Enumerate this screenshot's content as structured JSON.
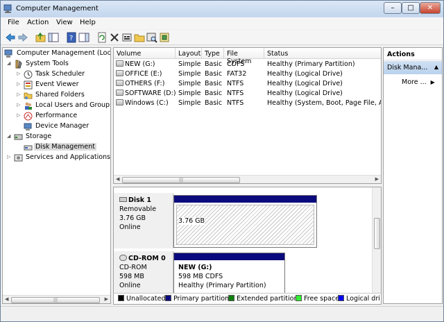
{
  "window": {
    "title": "Computer Management",
    "minimize": "–",
    "maximize": "□",
    "close": "✕"
  },
  "menu": [
    "File",
    "Action",
    "View",
    "Help"
  ],
  "toolbar_icons": [
    "back-arrow-icon",
    "forward-arrow-icon",
    "up-folder-icon",
    "show-hide-tree-icon",
    "help-icon",
    "show-hide-action-pane-icon",
    "refresh-icon",
    "delete-icon",
    "properties-icon",
    "open-folder-icon",
    "search-icon",
    "wizard-icon"
  ],
  "tree": {
    "root": "Computer Management (Local",
    "system_tools": "System Tools",
    "task_scheduler": "Task Scheduler",
    "event_viewer": "Event Viewer",
    "shared_folders": "Shared Folders",
    "local_users": "Local Users and Groups",
    "performance": "Performance",
    "device_manager": "Device Manager",
    "storage": "Storage",
    "disk_management": "Disk Management",
    "services": "Services and Applications"
  },
  "volume_table": {
    "columns": [
      "Volume",
      "Layout",
      "Type",
      "File System",
      "Status"
    ],
    "rows": [
      {
        "volume": "NEW (G:)",
        "layout": "Simple",
        "type": "Basic",
        "fs": "CDFS",
        "status": "Healthy (Primary Partition)"
      },
      {
        "volume": "OFFICE (E:)",
        "layout": "Simple",
        "type": "Basic",
        "fs": "FAT32",
        "status": "Healthy (Logical Drive)"
      },
      {
        "volume": "OTHERS (F:)",
        "layout": "Simple",
        "type": "Basic",
        "fs": "NTFS",
        "status": "Healthy (Logical Drive)"
      },
      {
        "volume": "SOFTWARE (D:)",
        "layout": "Simple",
        "type": "Basic",
        "fs": "NTFS",
        "status": "Healthy (Logical Drive)"
      },
      {
        "volume": "Windows (C:)",
        "layout": "Simple",
        "type": "Basic",
        "fs": "NTFS",
        "status": "Healthy (System, Boot, Page File, Acti"
      }
    ]
  },
  "disks": {
    "disk1": {
      "name": "Disk 1",
      "kind": "Removable",
      "size": "3.76 GB",
      "state": "Online",
      "partition_label": "3.76 GB"
    },
    "cdrom0": {
      "name": "CD-ROM 0",
      "kind": "CD-ROM",
      "size": "598 MB",
      "state": "Online",
      "partition_name": "NEW  (G:)",
      "partition_size": "598 MB CDFS",
      "partition_status": "Healthy (Primary Partition)"
    }
  },
  "legend": [
    {
      "label": "Unallocated",
      "color": "#000000"
    },
    {
      "label": "Primary partition",
      "color": "#0b0a7d"
    },
    {
      "label": "Extended partition",
      "color": "#0f7f0f"
    },
    {
      "label": "Free space",
      "color": "#33ee33"
    },
    {
      "label": "Logical dri",
      "color": "#0000ee"
    }
  ],
  "actions": {
    "title": "Actions",
    "section": "Disk Mana...",
    "more": "More ..."
  }
}
